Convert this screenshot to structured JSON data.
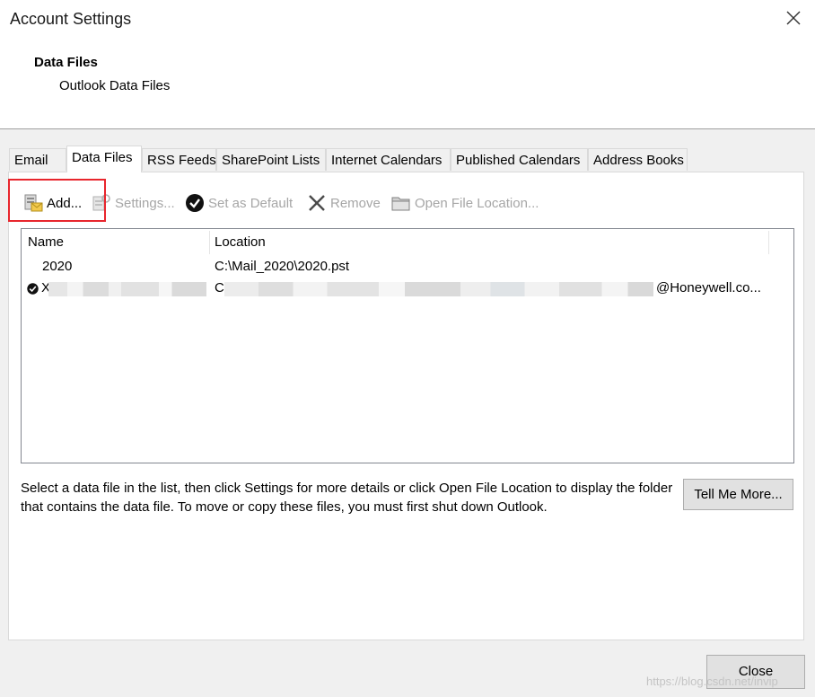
{
  "window": {
    "title": "Account Settings",
    "close_icon": "close-icon"
  },
  "section": {
    "title": "Data Files",
    "subtitle": "Outlook Data Files"
  },
  "tabs": [
    {
      "label": "Email"
    },
    {
      "label": "Data Files",
      "active": true
    },
    {
      "label": "RSS Feeds"
    },
    {
      "label": "SharePoint Lists"
    },
    {
      "label": "Internet Calendars"
    },
    {
      "label": "Published Calendars"
    },
    {
      "label": "Address Books"
    }
  ],
  "toolbar": {
    "add": {
      "label": "Add...",
      "icon": "add-data-file-icon",
      "enabled": true
    },
    "settings": {
      "label": "Settings...",
      "icon": "settings-icon",
      "enabled": false
    },
    "set_default": {
      "label": "Set as Default",
      "icon": "checkmark-circle-icon",
      "enabled": false
    },
    "remove": {
      "label": "Remove",
      "icon": "remove-x-icon",
      "enabled": false
    },
    "open_location": {
      "label": "Open File Location...",
      "icon": "folder-icon",
      "enabled": false
    }
  },
  "list": {
    "columns": [
      "Name",
      "Location"
    ],
    "rows": [
      {
        "name": "2020",
        "location": "C:\\Mail_2020\\2020.pst",
        "default": false
      },
      {
        "name": "X",
        "location_prefix": "C",
        "location_suffix": "@Honeywell.co...",
        "default": true,
        "redacted": true
      }
    ]
  },
  "info_text": "Select a data file in the list, then click Settings for more details or click Open File Location to display the folder that contains the data file. To move or copy these files, you must first shut down Outlook.",
  "tell_me_more": "Tell Me More...",
  "close_button": "Close",
  "watermark": "https://blog.csdn.net/invip",
  "colors": {
    "highlight": "#e8262d",
    "disabled_text": "#a6a6a6"
  }
}
